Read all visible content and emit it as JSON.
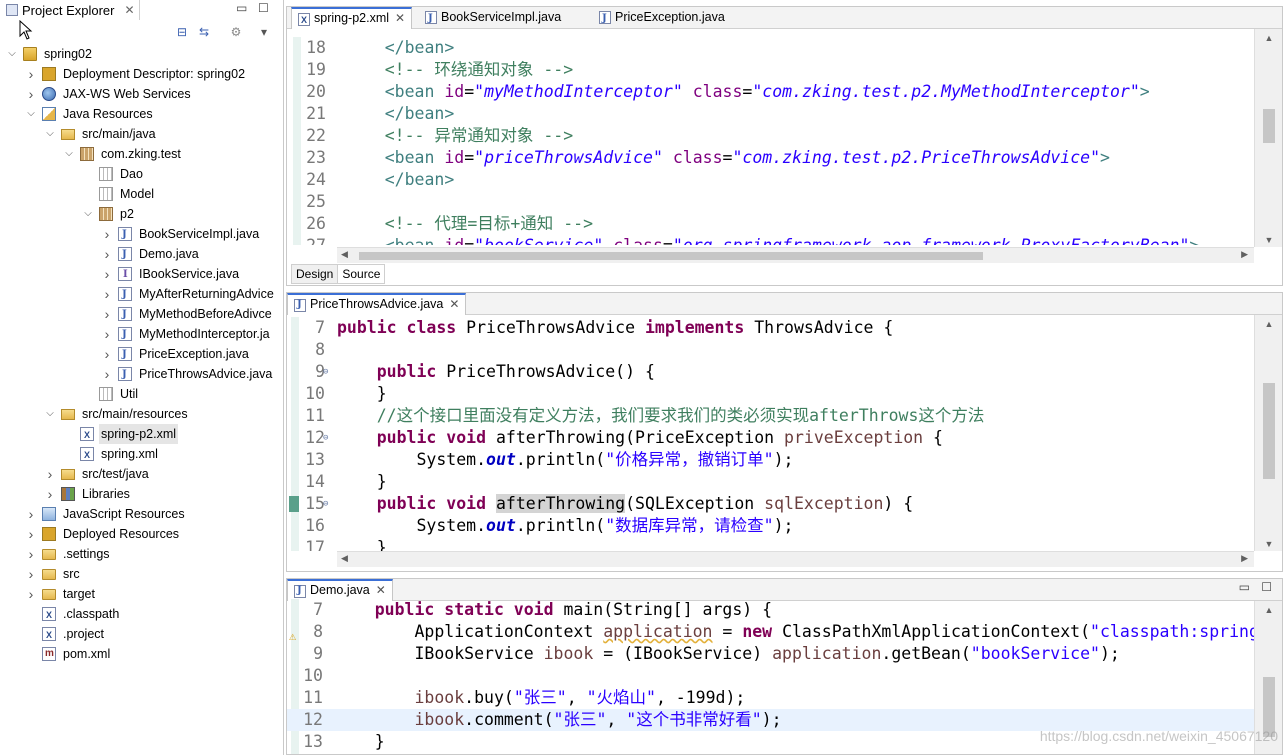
{
  "explorer": {
    "title": "Project Explorer",
    "tree": [
      {
        "indent": 0,
        "twisty": "open",
        "icon": "project",
        "label": "spring02"
      },
      {
        "indent": 1,
        "twisty": "closed",
        "icon": "dd",
        "label": "Deployment Descriptor: spring02"
      },
      {
        "indent": 1,
        "twisty": "closed",
        "icon": "web",
        "label": "JAX-WS Web Services"
      },
      {
        "indent": 1,
        "twisty": "open",
        "icon": "jr",
        "label": "Java Resources"
      },
      {
        "indent": 2,
        "twisty": "open",
        "icon": "srcfolder",
        "label": "src/main/java"
      },
      {
        "indent": 3,
        "twisty": "open",
        "icon": "pkg",
        "label": "com.zking.test"
      },
      {
        "indent": 4,
        "twisty": "none",
        "icon": "pkg-empty",
        "label": "Dao"
      },
      {
        "indent": 4,
        "twisty": "none",
        "icon": "pkg-empty",
        "label": "Model"
      },
      {
        "indent": 4,
        "twisty": "open",
        "icon": "pkg",
        "label": "p2"
      },
      {
        "indent": 5,
        "twisty": "closed",
        "icon": "java",
        "label": "BookServiceImpl.java"
      },
      {
        "indent": 5,
        "twisty": "closed",
        "icon": "java",
        "label": "Demo.java"
      },
      {
        "indent": 5,
        "twisty": "closed",
        "icon": "iface",
        "label": "IBookService.java"
      },
      {
        "indent": 5,
        "twisty": "closed",
        "icon": "java",
        "label": "MyAfterReturningAdvice"
      },
      {
        "indent": 5,
        "twisty": "closed",
        "icon": "java",
        "label": "MyMethodBeforeAdivce"
      },
      {
        "indent": 5,
        "twisty": "closed",
        "icon": "java",
        "label": "MyMethodInterceptor.ja"
      },
      {
        "indent": 5,
        "twisty": "closed",
        "icon": "java",
        "label": "PriceException.java"
      },
      {
        "indent": 5,
        "twisty": "closed",
        "icon": "java",
        "label": "PriceThrowsAdvice.java"
      },
      {
        "indent": 4,
        "twisty": "none",
        "icon": "pkg-empty",
        "label": "Util"
      },
      {
        "indent": 2,
        "twisty": "open",
        "icon": "srcfolder",
        "label": "src/main/resources"
      },
      {
        "indent": 3,
        "twisty": "none",
        "icon": "xml",
        "label": "spring-p2.xml",
        "selected": true
      },
      {
        "indent": 3,
        "twisty": "none",
        "icon": "xml",
        "label": "spring.xml"
      },
      {
        "indent": 2,
        "twisty": "closed",
        "icon": "srcfolder",
        "label": "src/test/java"
      },
      {
        "indent": 2,
        "twisty": "closed",
        "icon": "lib",
        "label": "Libraries"
      },
      {
        "indent": 1,
        "twisty": "closed",
        "icon": "jsr",
        "label": "JavaScript Resources"
      },
      {
        "indent": 1,
        "twisty": "closed",
        "icon": "dd",
        "label": "Deployed Resources"
      },
      {
        "indent": 1,
        "twisty": "closed",
        "icon": "folder",
        "label": ".settings"
      },
      {
        "indent": 1,
        "twisty": "closed",
        "icon": "folder",
        "label": "src"
      },
      {
        "indent": 1,
        "twisty": "closed",
        "icon": "folder",
        "label": "target"
      },
      {
        "indent": 1,
        "twisty": "none",
        "icon": "xml",
        "label": ".classpath"
      },
      {
        "indent": 1,
        "twisty": "none",
        "icon": "xml",
        "label": ".project"
      },
      {
        "indent": 1,
        "twisty": "none",
        "icon": "mf",
        "label": "pom.xml"
      }
    ]
  },
  "editor1": {
    "tabs": [
      {
        "label": "spring-p2.xml",
        "icon": "xml",
        "active": true
      },
      {
        "label": "BookServiceImpl.java",
        "icon": "java",
        "active": false
      },
      {
        "label": "PriceException.java",
        "icon": "java",
        "active": false
      }
    ],
    "bottom_tabs": [
      "Design",
      "Source"
    ],
    "lines": [
      {
        "n": "18",
        "tokens": [
          [
            "tag",
            "    </bean>"
          ]
        ]
      },
      {
        "n": "19",
        "tokens": [
          [
            "cm",
            "    <!-- 环绕通知对象 -->"
          ]
        ]
      },
      {
        "n": "20",
        "tokens": [
          [
            "tag",
            "    <bean "
          ],
          [
            "attr",
            "id"
          ],
          [
            "",
            "="
          ],
          [
            "aval",
            "\"myMethodInterceptor\""
          ],
          [
            "attr",
            " class"
          ],
          [
            "",
            "="
          ],
          [
            "aval",
            "\"com.zking.test.p2.MyMethodInterceptor\""
          ],
          [
            "tag",
            ">"
          ]
        ]
      },
      {
        "n": "21",
        "tokens": [
          [
            "tag",
            "    </bean>"
          ]
        ]
      },
      {
        "n": "22",
        "tokens": [
          [
            "cm",
            "    <!-- 异常通知对象 -->"
          ]
        ]
      },
      {
        "n": "23",
        "tokens": [
          [
            "tag",
            "    <bean "
          ],
          [
            "attr",
            "id"
          ],
          [
            "",
            "="
          ],
          [
            "aval",
            "\"priceThrowsAdvice\""
          ],
          [
            "attr",
            " class"
          ],
          [
            "",
            "="
          ],
          [
            "aval",
            "\"com.zking.test.p2.PriceThrowsAdvice\""
          ],
          [
            "tag",
            ">"
          ]
        ]
      },
      {
        "n": "24",
        "tokens": [
          [
            "tag",
            "    </bean>"
          ]
        ]
      },
      {
        "n": "25",
        "tokens": []
      },
      {
        "n": "26",
        "tokens": [
          [
            "cm",
            "    <!-- 代理=目标+通知 -->"
          ]
        ]
      },
      {
        "n": "27",
        "tokens": [
          [
            "tag",
            "    <bean "
          ],
          [
            "attr",
            "id"
          ],
          [
            "",
            "="
          ],
          [
            "aval",
            "\"bookService\""
          ],
          [
            "attr",
            " class"
          ],
          [
            "",
            "="
          ],
          [
            "aval",
            "\"org.springframework.aop.framework.ProxyFactoryBean\""
          ],
          [
            "tag",
            ">"
          ]
        ]
      }
    ]
  },
  "editor2": {
    "tab": "PriceThrowsAdvice.java",
    "lines": [
      {
        "n": "7",
        "tokens": [
          [
            "kw",
            "public class "
          ],
          [
            "",
            "PriceThrowsAdvice "
          ],
          [
            "kw",
            "implements "
          ],
          [
            "",
            "ThrowsAdvice {"
          ]
        ]
      },
      {
        "n": "8",
        "tokens": []
      },
      {
        "n": "9",
        "fold": true,
        "tokens": [
          [
            "kw",
            "    public "
          ],
          [
            "",
            "PriceThrowsAdvice() {"
          ]
        ]
      },
      {
        "n": "10",
        "tokens": [
          [
            "",
            "    }"
          ]
        ]
      },
      {
        "n": "11",
        "tokens": [
          [
            "cm",
            "    //这个接口里面没有定义方法，我们要求我们的类必须实现afterThrows这个方法"
          ]
        ]
      },
      {
        "n": "12",
        "fold": true,
        "tokens": [
          [
            "kw",
            "    public void "
          ],
          [
            "",
            "afterThrowing(PriceException "
          ],
          [
            "param",
            "priveException"
          ],
          [
            "",
            " {"
          ]
        ]
      },
      {
        "n": "13",
        "tokens": [
          [
            "",
            "        System."
          ],
          [
            "fld",
            "out"
          ],
          [
            "",
            ".println("
          ],
          [
            "str",
            "\"价格异常，撤销订单\""
          ],
          [
            "",
            ");"
          ]
        ]
      },
      {
        "n": "14",
        "tokens": [
          [
            "",
            "    }"
          ]
        ]
      },
      {
        "n": "15",
        "fold": true,
        "mark": true,
        "tokens": [
          [
            "kw",
            "    public void "
          ],
          [
            "occ",
            "afterThrowing"
          ],
          [
            "",
            "(SQLException "
          ],
          [
            "param",
            "sqlException"
          ],
          [
            "",
            ") {"
          ]
        ]
      },
      {
        "n": "16",
        "tokens": [
          [
            "",
            "        System."
          ],
          [
            "fld",
            "out"
          ],
          [
            "",
            ".println("
          ],
          [
            "str",
            "\"数据库异常，请检查\""
          ],
          [
            "",
            ");"
          ]
        ]
      },
      {
        "n": "17",
        "tokens": [
          [
            "",
            "    }"
          ]
        ]
      }
    ]
  },
  "editor3": {
    "tab": "Demo.java",
    "lines": [
      {
        "n": "7",
        "tokens": [
          [
            "kw",
            "    public static void "
          ],
          [
            "",
            "main(String[] args) {"
          ]
        ]
      },
      {
        "n": "8",
        "warn": true,
        "tokens": [
          [
            "",
            "        ApplicationContext "
          ],
          [
            "warnparam",
            "application"
          ],
          [
            "",
            " = "
          ],
          [
            "kw",
            "new "
          ],
          [
            "",
            "ClassPathXmlApplicationContext("
          ],
          [
            "str",
            "\"classpath:spring"
          ]
        ]
      },
      {
        "n": "9",
        "tokens": [
          [
            "",
            "        IBookService "
          ],
          [
            "param",
            "ibook"
          ],
          [
            "",
            " = (IBookService) "
          ],
          [
            "param",
            "application"
          ],
          [
            "",
            ".getBean("
          ],
          [
            "str",
            "\"bookService\""
          ],
          [
            "",
            ");"
          ]
        ]
      },
      {
        "n": "10",
        "tokens": []
      },
      {
        "n": "11",
        "tokens": [
          [
            "param",
            "        ibook"
          ],
          [
            "",
            ".buy("
          ],
          [
            "str",
            "\"张三\""
          ],
          [
            "",
            ", "
          ],
          [
            "str",
            "\"火焰山\""
          ],
          [
            "",
            ", -199d);"
          ]
        ]
      },
      {
        "n": "12",
        "highlight": true,
        "tokens": [
          [
            "param",
            "        ibook"
          ],
          [
            "",
            ".comment("
          ],
          [
            "str",
            "\"张三\""
          ],
          [
            "",
            ", "
          ],
          [
            "str",
            "\"这个书非常好看\""
          ],
          [
            "",
            ");"
          ]
        ]
      },
      {
        "n": "13",
        "tokens": [
          [
            "",
            "    }"
          ]
        ]
      }
    ]
  },
  "watermark": "https://blog.csdn.net/weixin_45067120"
}
